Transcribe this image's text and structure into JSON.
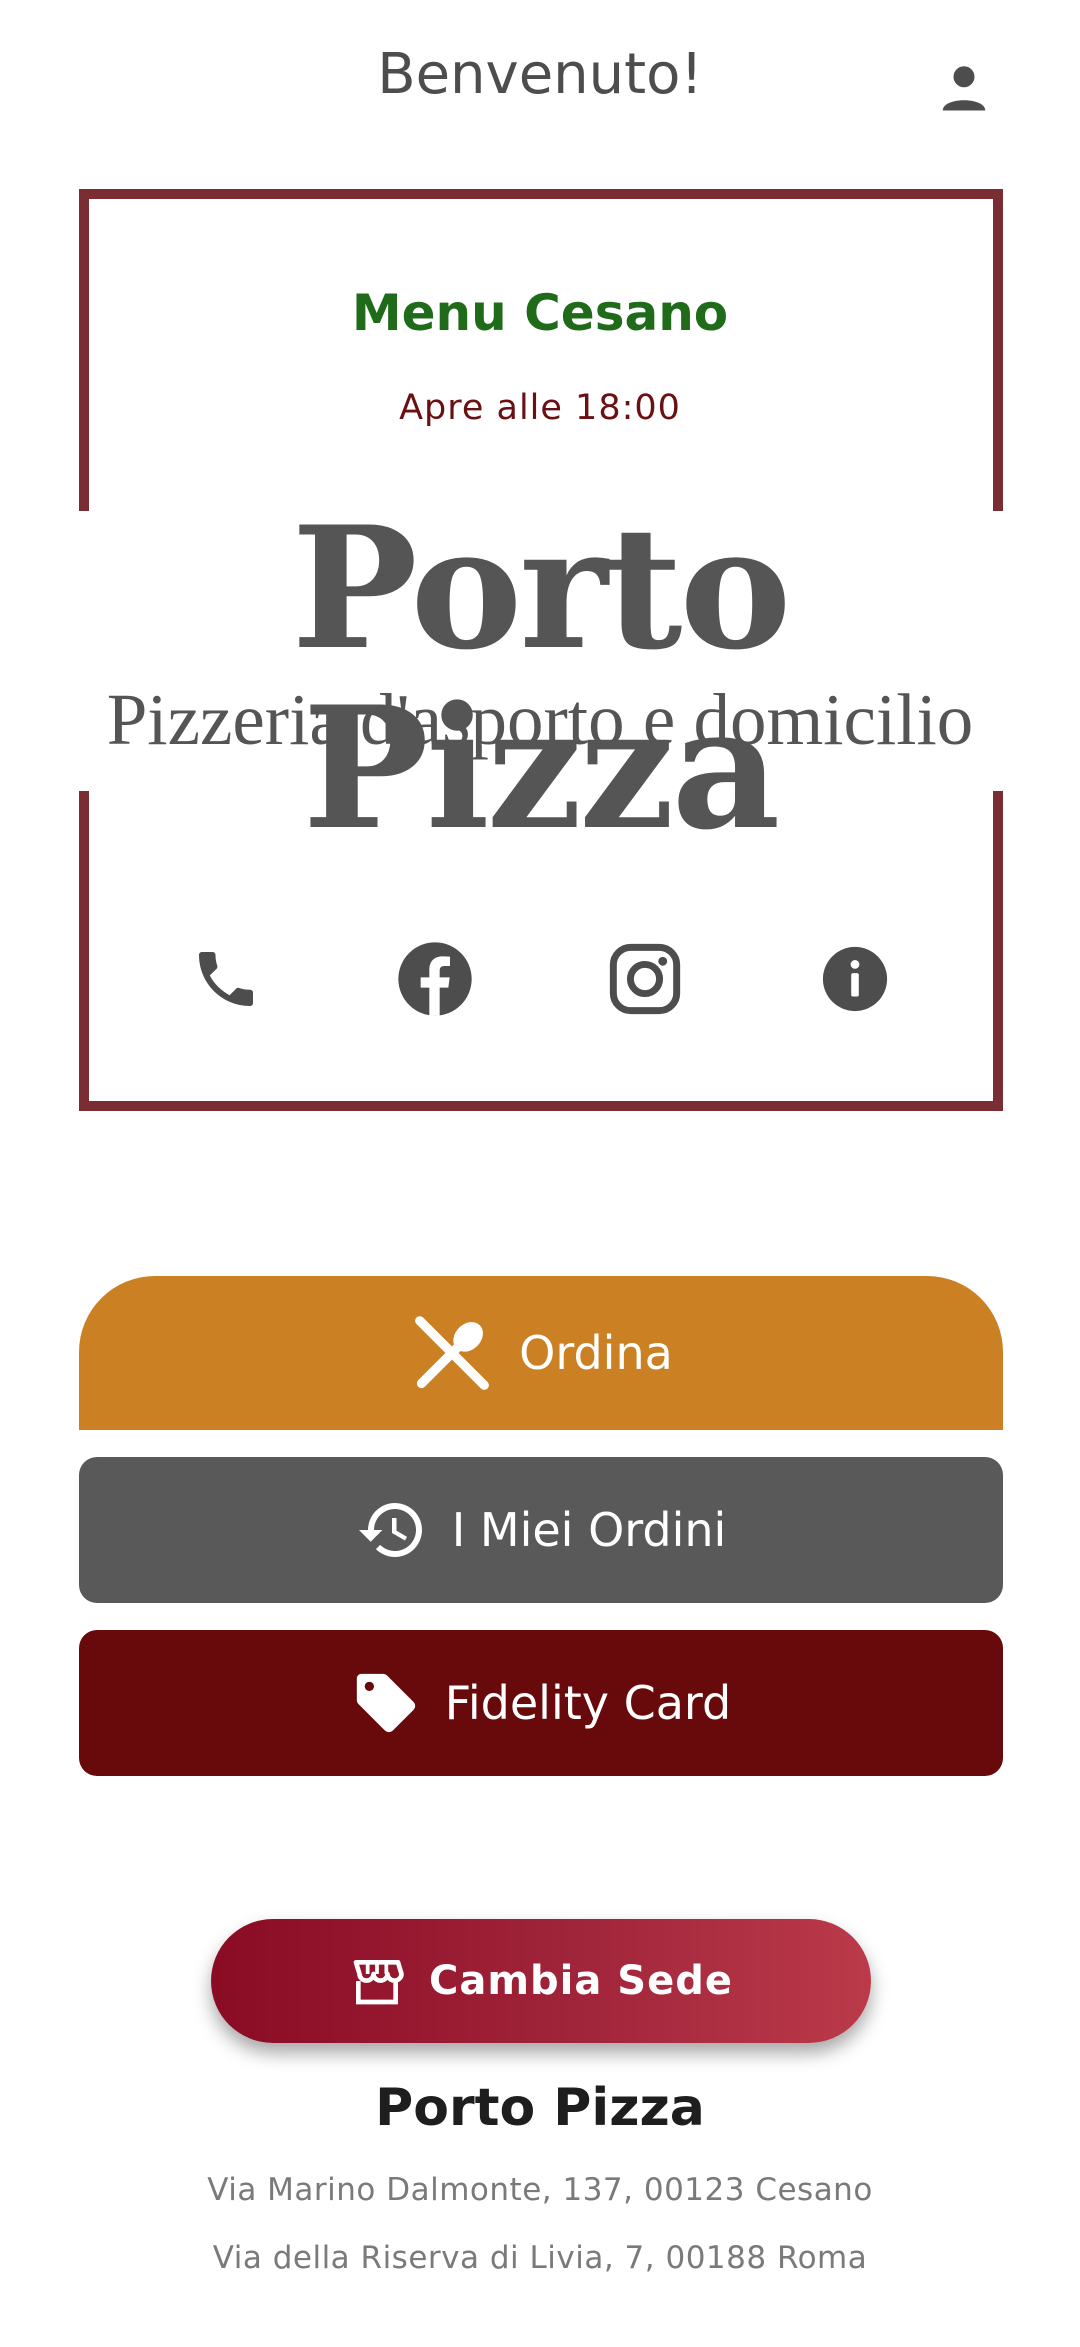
{
  "header": {
    "title": "Benvenuto!",
    "account_icon": "account-icon"
  },
  "store_card": {
    "menu_title": "Menu Cesano",
    "opening_text": "Apre alle 18:00",
    "logo_main": "Porto Pizza",
    "logo_sub": "Pizzeria d'asporto e domicilio",
    "social_icons": [
      "phone-icon",
      "facebook-icon",
      "instagram-icon",
      "info-icon"
    ]
  },
  "actions": {
    "ordina_label": "Ordina",
    "ordini_label": "I Miei Ordini",
    "fidelity_label": "Fidelity Card",
    "sede_label": "Cambia Sede"
  },
  "footer": {
    "title": "Porto Pizza",
    "address_1": "Via Marino Dalmonte, 137, 00123 Cesano",
    "address_2": "Via della Riserva di Livia, 7, 00188 Roma"
  },
  "colors": {
    "frame": "#7a2d32",
    "menu_title": "#1f6b1a",
    "opening_text": "#6a0f12",
    "ordina": "#ca8023",
    "ordini": "#595959",
    "fidelity": "#680a0b",
    "sede_start": "#8a0b24",
    "sede_end": "#bb3a4a"
  }
}
